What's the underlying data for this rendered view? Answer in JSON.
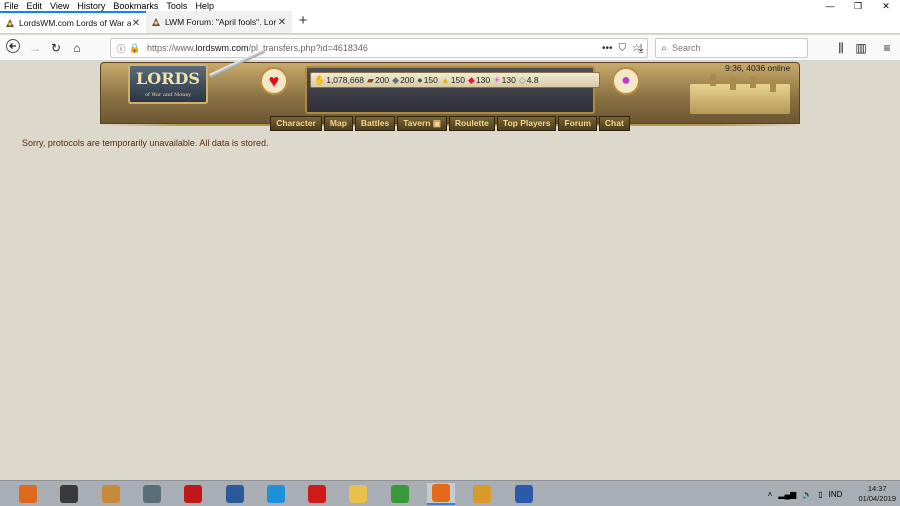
{
  "menubar": {
    "items": [
      "File",
      "Edit",
      "View",
      "History",
      "Bookmarks",
      "Tools",
      "Help"
    ],
    "window_controls": [
      "—",
      "❐",
      "✕"
    ]
  },
  "tabs": [
    {
      "title": "LordsWM.com Lords of War an",
      "active": true
    },
    {
      "title": "LWM Forum: \"April fools\". Lor",
      "active": false
    }
  ],
  "navbar": {
    "url_prefix": "https://www.",
    "url_host": "lordswm.com",
    "url_path": "/pl_transfers.php?id=4618346",
    "search_placeholder": "Search"
  },
  "game": {
    "logo_text": "LORDS",
    "logo_sub": "of War and Money",
    "server_time": "9:36, 4036 online",
    "resources": [
      {
        "icon": "gold-icon",
        "glyph": "✋",
        "color": "#c8901a",
        "value": "1,078,668"
      },
      {
        "icon": "wood-icon",
        "glyph": "▰",
        "color": "#8a4a1a",
        "value": "200"
      },
      {
        "icon": "ore-icon",
        "glyph": "◆",
        "color": "#6a6f78",
        "value": "200"
      },
      {
        "icon": "mercury-icon",
        "glyph": "●",
        "color": "#4a4f58",
        "value": "150"
      },
      {
        "icon": "sulfur-icon",
        "glyph": "▲",
        "color": "#e2b714",
        "value": "150"
      },
      {
        "icon": "crystal-icon",
        "glyph": "◆",
        "color": "#d0203a",
        "value": "130"
      },
      {
        "icon": "gems-icon",
        "glyph": "✦",
        "color": "#d27ad8",
        "value": "130"
      },
      {
        "icon": "diamond-icon",
        "glyph": "◇",
        "color": "#4aa6d8",
        "value": "4.8"
      }
    ],
    "nav": [
      "Character",
      "Map",
      "Battles",
      "Tavern",
      "Roulette",
      "Top Players",
      "Forum",
      "Chat"
    ],
    "tavern_badge": "▣"
  },
  "message": "Sorry, protocols are temporarily unavailable. All data is stored.",
  "taskbar": {
    "apps": [
      {
        "name": "media-player-icon",
        "color": "#e0681a"
      },
      {
        "name": "camera-app-icon",
        "color": "#3a3a3a"
      },
      {
        "name": "game-launcher-icon",
        "color": "#c58a3a"
      },
      {
        "name": "toolbox-app-icon",
        "color": "#5a6e7a"
      },
      {
        "name": "power-app-icon",
        "color": "#c01818"
      },
      {
        "name": "settings-app-icon",
        "color": "#2a5a9a"
      },
      {
        "name": "internet-explorer-icon",
        "color": "#1e90d8"
      },
      {
        "name": "acrobat-icon",
        "color": "#d01a1a"
      },
      {
        "name": "file-explorer-icon",
        "color": "#e8c04a"
      },
      {
        "name": "chrome-icon",
        "color": "#3a9a3a"
      },
      {
        "name": "firefox-icon",
        "color": "#e46a1a"
      },
      {
        "name": "pen-app-icon",
        "color": "#d89a2a"
      },
      {
        "name": "word-icon",
        "color": "#2a5aa8"
      }
    ],
    "active_app": "firefox-icon",
    "language": "IND",
    "time": "14:37",
    "date": "01/04/2019"
  }
}
